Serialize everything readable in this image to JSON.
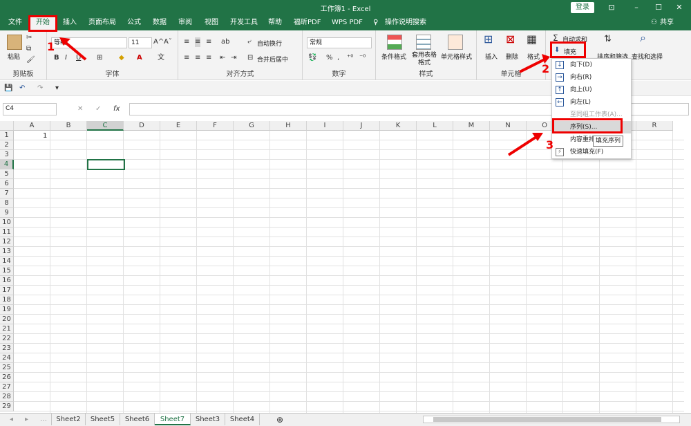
{
  "window": {
    "title": "工作簿1 - Excel",
    "login": "登录",
    "share": "共享"
  },
  "tabs": [
    "文件",
    "开始",
    "插入",
    "页面布局",
    "公式",
    "数据",
    "审阅",
    "视图",
    "开发工具",
    "帮助",
    "福昕PDF",
    "WPS PDF",
    "操作说明搜索"
  ],
  "ribbon": {
    "clipboard": {
      "paste": "粘贴",
      "label": "剪贴板"
    },
    "font": {
      "name": "等线",
      "size": "11",
      "bold": "B",
      "italic": "I",
      "underline": "U",
      "grow": "A^",
      "shrink": "Aˇ",
      "label": "字体"
    },
    "align": {
      "wrap": "自动换行",
      "merge": "合并后居中",
      "label": "对齐方式"
    },
    "number": {
      "format": "常规",
      "percent": "%",
      "comma": ",",
      "label": "数字"
    },
    "styles": {
      "conditional": "条件格式",
      "table": "套用表格格式",
      "cell": "单元格样式",
      "label": "样式"
    },
    "cells": {
      "insert": "插入",
      "delete": "删除",
      "format": "格式",
      "label": "单元格"
    },
    "editing": {
      "autosum": "自动求和",
      "fill": "填充",
      "sort": "排序和筛选",
      "find": "查找和选择"
    }
  },
  "formula_bar": {
    "name_box": "C4",
    "fx": "fx",
    "value": ""
  },
  "grid": {
    "columns": [
      "A",
      "B",
      "C",
      "D",
      "E",
      "F",
      "G",
      "H",
      "I",
      "J",
      "K",
      "L",
      "M",
      "N",
      "O",
      "P",
      "Q",
      "R"
    ],
    "rows": [
      "1",
      "2",
      "3",
      "4",
      "5",
      "6",
      "7",
      "8",
      "9",
      "10",
      "11",
      "12",
      "13",
      "14",
      "15",
      "16",
      "17",
      "18",
      "19",
      "20",
      "21",
      "22",
      "23",
      "24",
      "25",
      "26",
      "27",
      "28",
      "29"
    ],
    "selected_cell": "C4",
    "a1_value": "1"
  },
  "fill_menu": {
    "items": [
      {
        "label": "向下(D)",
        "icon": "arrow-down"
      },
      {
        "label": "向右(R)",
        "icon": "arrow-right"
      },
      {
        "label": "向上(U)",
        "icon": "arrow-up"
      },
      {
        "label": "向左(L)",
        "icon": "arrow-left"
      },
      {
        "label": "至同组工作表(A)...",
        "icon": ""
      },
      {
        "label": "序列(S)...",
        "icon": ""
      },
      {
        "label": "内容重排",
        "icon": ""
      },
      {
        "label": "快速填充(F)",
        "icon": "flash-fill"
      }
    ],
    "tooltip": "填充序列"
  },
  "sheets": [
    "Sheet2",
    "Sheet5",
    "Sheet6",
    "Sheet7",
    "Sheet3",
    "Sheet4"
  ],
  "active_sheet": "Sheet7",
  "annotations": [
    "1",
    "2",
    "3"
  ],
  "colors": {
    "accent": "#217346",
    "highlight": "#e00000"
  }
}
